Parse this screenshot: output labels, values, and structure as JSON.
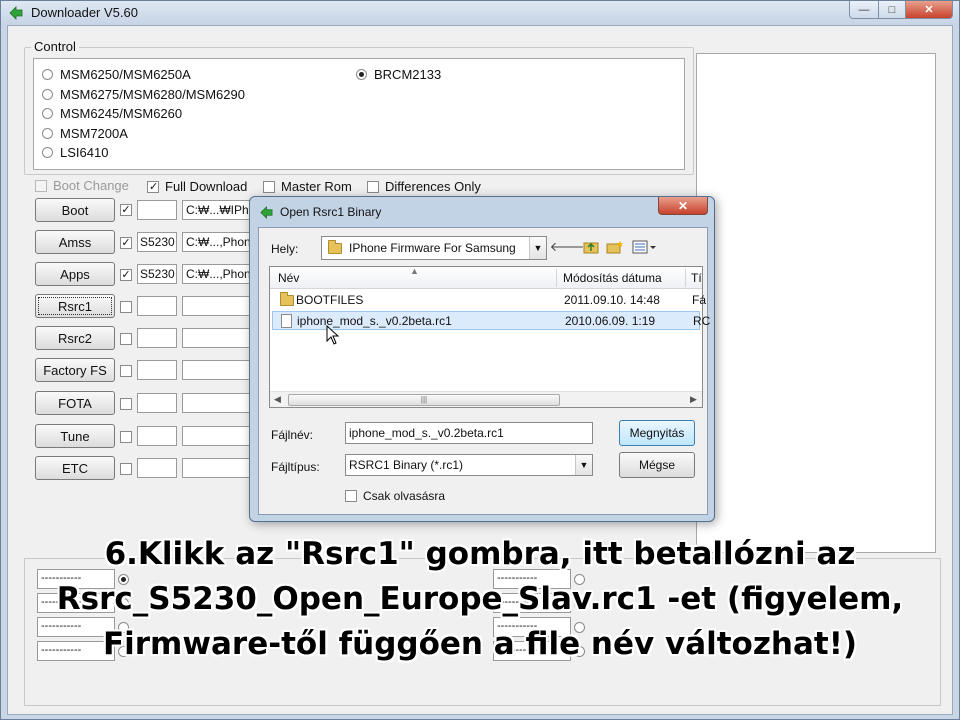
{
  "window": {
    "title": "Downloader V5.60",
    "min_glyph": "—",
    "max_glyph": "□",
    "close_glyph": "✕"
  },
  "control": {
    "legend": "Control",
    "radios_left": [
      "MSM6250/MSM6250A",
      "MSM6275/MSM6280/MSM6290",
      "MSM6245/MSM6260",
      "MSM7200A",
      "LSI6410"
    ],
    "radio_right": "BRCM2133"
  },
  "options": {
    "boot_change": "Boot Change",
    "full_download": "Full Download",
    "master_rom": "Master Rom",
    "differences_only": "Differences Only"
  },
  "rows": [
    {
      "button": "Boot",
      "checked": true,
      "code": "",
      "path": "C:₩...₩IPh"
    },
    {
      "button": "Amss",
      "checked": true,
      "code": "S5230",
      "path": "C:₩...,Phon"
    },
    {
      "button": "Apps",
      "checked": true,
      "code": "S5230",
      "path": "C:₩...,Phon"
    },
    {
      "button": "Rsrc1",
      "checked": false,
      "code": "",
      "path": ""
    },
    {
      "button": "Rsrc2",
      "checked": false,
      "code": "",
      "path": ""
    },
    {
      "button": "Factory FS",
      "checked": false,
      "code": "",
      "path": ""
    },
    {
      "button": "FOTA",
      "checked": false,
      "code": "",
      "path": ""
    },
    {
      "button": "Tune",
      "checked": false,
      "code": "",
      "path": ""
    },
    {
      "button": "ETC",
      "checked": false,
      "code": "",
      "path": ""
    }
  ],
  "ports": {
    "placeholder": "-----------"
  },
  "dialog": {
    "title": "Open Rsrc1 Binary",
    "close_glyph": "✕",
    "location_label": "Hely:",
    "location_value": "IPhone Firmware For Samsung",
    "columns": {
      "name": "Név",
      "modified": "Módosítás dátuma",
      "type": "Tí"
    },
    "files": [
      {
        "name": "BOOTFILES",
        "date": "2011.09.10. 14:48",
        "type": "Fá",
        "kind": "folder"
      },
      {
        "name": "iphone_mod_s._v0.2beta.rc1",
        "date": "2010.06.09. 1:19",
        "type": "RC",
        "kind": "file",
        "selected": true
      }
    ],
    "filename_label": "Fájlnév:",
    "filename_value": "iphone_mod_s._v0.2beta.rc1",
    "filetype_label": "Fájltípus:",
    "filetype_value": "RSRC1 Binary (*.rc1)",
    "open_label": "Megnyitás",
    "cancel_label": "Mégse",
    "readonly_label": "Csak olvasásra"
  },
  "caption": {
    "line1": "6.Klikk az \"Rsrc1\" gombra, itt betallózni az",
    "line2": "Rsrc_S5230_Open_Europe_Slav.rc1 -et (figyelem,",
    "line3": "Firmware-től függően a file név változhat!)"
  }
}
